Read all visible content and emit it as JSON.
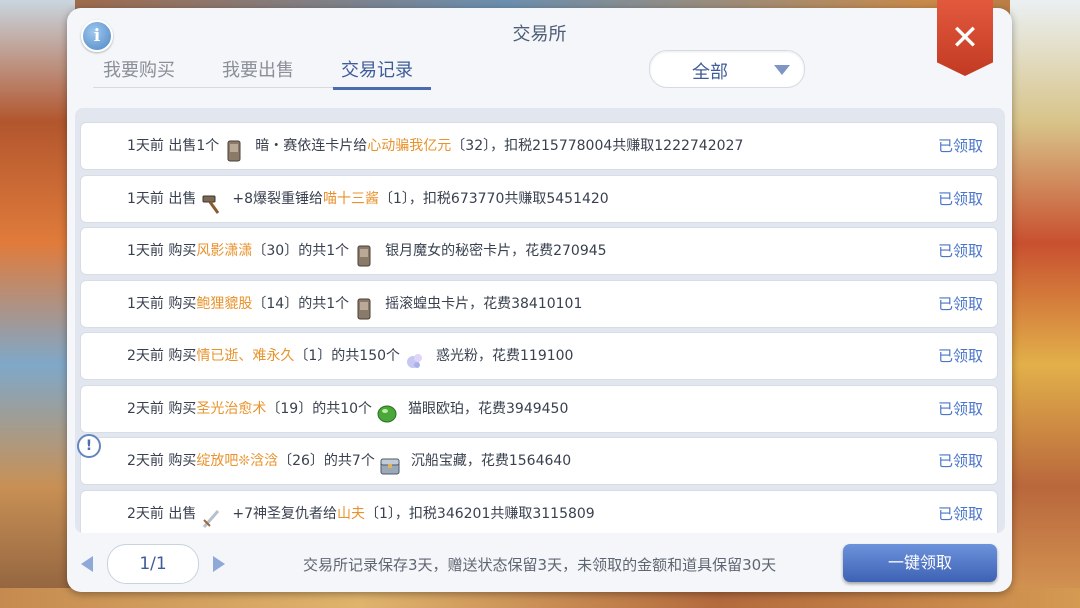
{
  "window": {
    "title": "交易所"
  },
  "tabs": [
    {
      "label": "我要购买"
    },
    {
      "label": "我要出售"
    },
    {
      "label": "交易记录"
    }
  ],
  "filter": {
    "selected": "全部"
  },
  "records": [
    {
      "time": "1天前",
      "pre": "出售1个",
      "icon": "card-icon",
      "post": "暗・赛依连卡片给",
      "player": "心动骗我亿元",
      "detail": "〔32〕，扣税215778004共赚取1222742027",
      "status": "已领取"
    },
    {
      "time": "1天前",
      "pre": "出售",
      "icon": "hammer-icon",
      "post": "+8爆裂重锤给",
      "player": "喵十三酱",
      "detail": "〔1〕，扣税673770共赚取5451420",
      "status": "已领取"
    },
    {
      "time": "1天前",
      "pre": "购买",
      "player": "风影潇潇",
      "mid": "〔30〕的共1个",
      "icon": "card-icon",
      "post": "银月魔女的秘密卡片，花费270945",
      "status": "已领取"
    },
    {
      "time": "1天前",
      "pre": "购买",
      "player": "鲍狸貔股",
      "mid": "〔14〕的共1个",
      "icon": "card-icon",
      "post": "摇滚蝗虫卡片，花费38410101",
      "status": "已领取"
    },
    {
      "time": "2天前",
      "pre": "购买",
      "player": "情已逝、难永久",
      "mid": "〔1〕的共150个",
      "icon": "powder-icon",
      "post": "惑光粉，花费119100",
      "status": "已领取"
    },
    {
      "time": "2天前",
      "pre": "购买",
      "player": "圣光治愈术",
      "mid": "〔19〕的共10个",
      "icon": "gem-icon",
      "post": "猫眼欧珀，花费3949450",
      "status": "已领取"
    },
    {
      "time": "2天前",
      "pre": "购买",
      "player": "绽放吧❊浛浛",
      "mid": "〔26〕的共7个",
      "icon": "chest-icon",
      "post": "沉船宝藏，花费1564640",
      "status": "已领取"
    },
    {
      "time": "2天前",
      "pre": "出售",
      "icon": "sword-icon",
      "post": "+7神圣复仇者给",
      "player": "山夫",
      "detail": "〔1〕，扣税346201共赚取3115809",
      "status": "已领取"
    }
  ],
  "pager": {
    "page": "1/1"
  },
  "footer": {
    "note": "交易所记录保存3天，赠送状态保留3天，未领取的金额和道具保留30天",
    "claim_all": "一键领取"
  },
  "colors": {
    "accent": "#3f5c98",
    "highlight": "#e8932d",
    "close": "#d44a30"
  }
}
